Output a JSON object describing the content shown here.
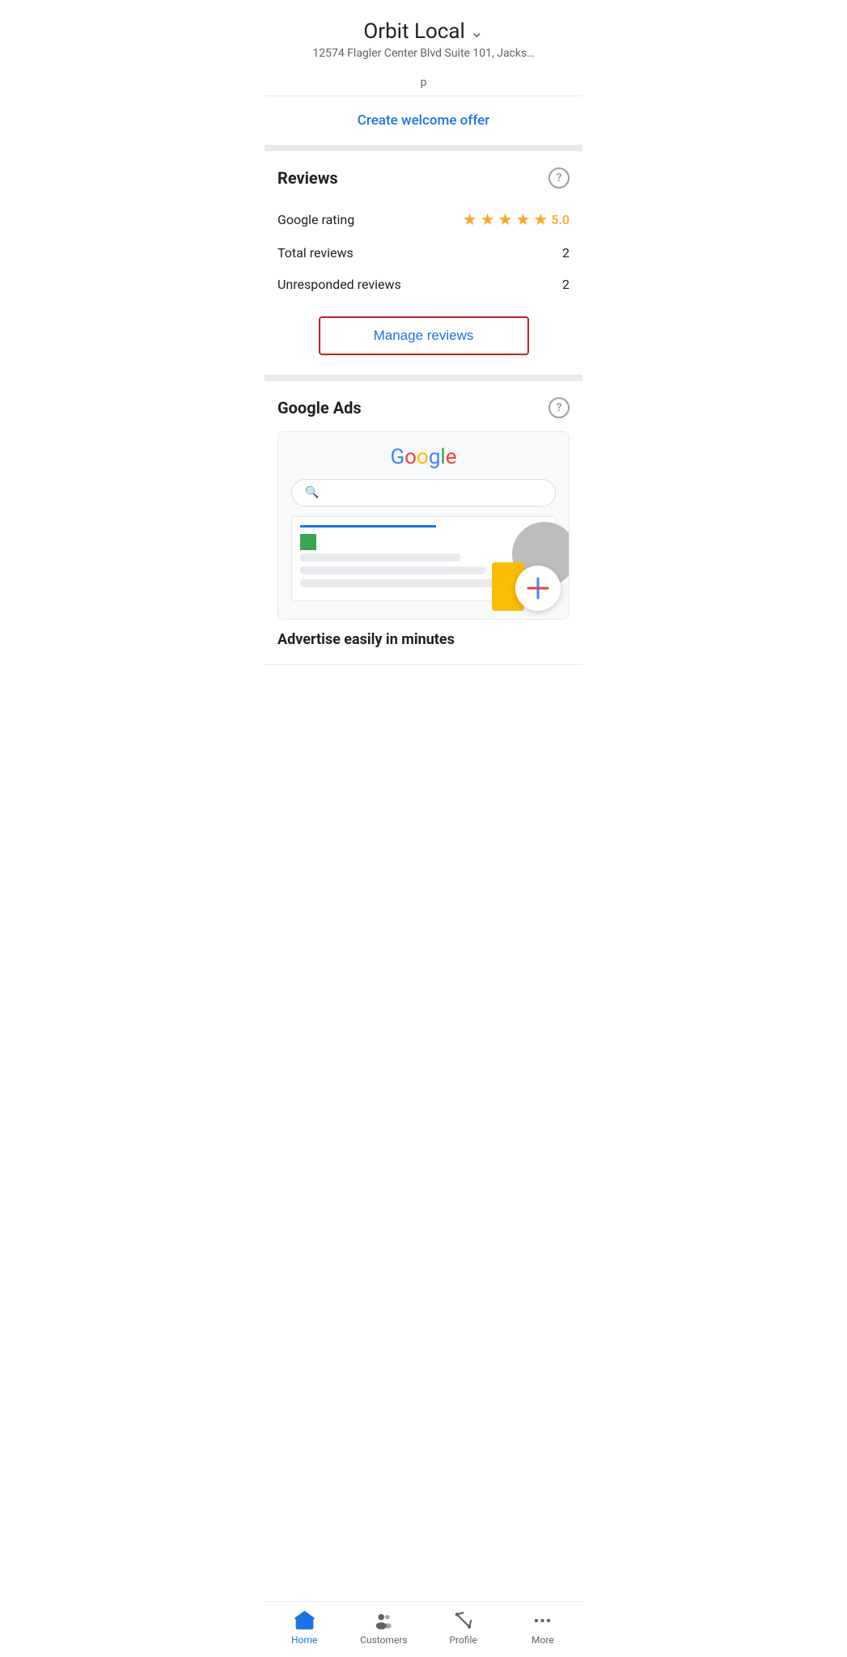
{
  "header": {
    "business_name": "Orbit Local",
    "business_address": "12574 Flagler Center Blvd Suite 101, Jacks…",
    "chevron": "∨"
  },
  "welcome_offer": {
    "link_text": "Create welcome offer"
  },
  "reviews": {
    "section_title": "Reviews",
    "google_rating_label": "Google rating",
    "google_rating_value": "5.0",
    "stars_count": 5,
    "total_reviews_label": "Total reviews",
    "total_reviews_value": "2",
    "unresponded_label": "Unresponded reviews",
    "unresponded_value": "2",
    "manage_button_label": "Manage reviews"
  },
  "google_ads": {
    "section_title": "Google Ads",
    "google_logo": "Google",
    "advertise_text": "Advertise easily in minutes"
  },
  "bottom_nav": {
    "items": [
      {
        "id": "home",
        "label": "Home",
        "active": true
      },
      {
        "id": "customers",
        "label": "Customers",
        "active": false
      },
      {
        "id": "profile",
        "label": "Profile",
        "active": false
      },
      {
        "id": "more",
        "label": "More",
        "active": false
      }
    ]
  }
}
